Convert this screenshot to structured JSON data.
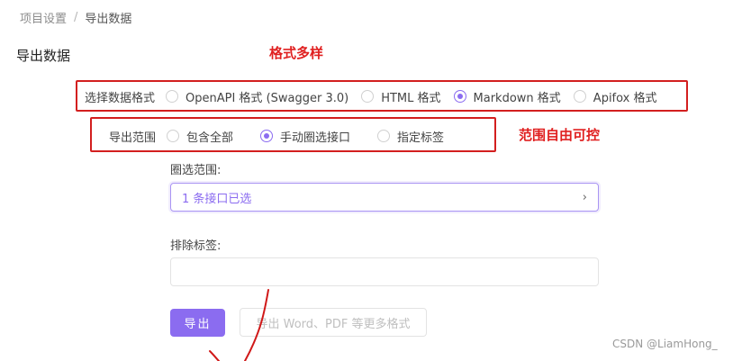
{
  "breadcrumb": {
    "parent": "项目设置",
    "separator": "/",
    "current": "导出数据"
  },
  "page_title": "导出数据",
  "annotations": {
    "format_note": "格式多样",
    "scope_note": "范围自由可控"
  },
  "format": {
    "label": "选择数据格式",
    "options": [
      {
        "label": "OpenAPI 格式 (Swagger 3.0)",
        "checked": false
      },
      {
        "label": "HTML 格式",
        "checked": false
      },
      {
        "label": "Markdown 格式",
        "checked": true
      },
      {
        "label": "Apifox 格式",
        "checked": false
      }
    ]
  },
  "scope": {
    "label": "导出范围",
    "options": [
      {
        "label": "包含全部",
        "checked": false
      },
      {
        "label": "手动圈选接口",
        "checked": true
      },
      {
        "label": "指定标签",
        "checked": false
      }
    ]
  },
  "selection": {
    "label": "圈选范围:",
    "value": "1 条接口已选",
    "chevron": "›"
  },
  "exclude": {
    "label": "排除标签:",
    "value": ""
  },
  "actions": {
    "export_label": "导出",
    "more_formats_label": "导出 Word、PDF 等更多格式"
  },
  "watermark": "CSDN @LiamHong_",
  "colors": {
    "accent": "#8b6cf0",
    "annotation": "#e02020"
  }
}
